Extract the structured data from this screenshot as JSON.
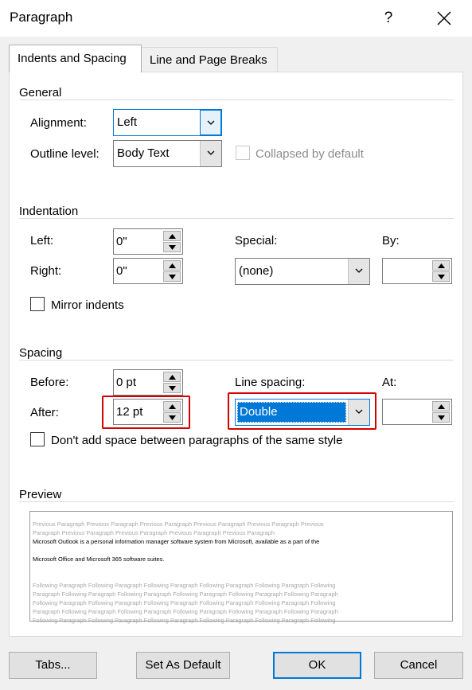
{
  "window": {
    "title": "Paragraph",
    "help_label": "?",
    "colors": {
      "accent": "#0078d7",
      "highlight_red": "#d40000",
      "selection": "#0078d7"
    }
  },
  "tabs": [
    {
      "label": "Indents and Spacing",
      "active": true
    },
    {
      "label": "Line and Page Breaks",
      "active": false
    }
  ],
  "general": {
    "heading": "General",
    "alignment": {
      "label": "Alignment:",
      "value": "Left"
    },
    "outline_level": {
      "label": "Outline level:",
      "value": "Body Text"
    },
    "collapsed": {
      "label": "Collapsed by default",
      "checked": false,
      "enabled": false
    }
  },
  "indentation": {
    "heading": "Indentation",
    "left": {
      "label": "Left:",
      "value": "0\""
    },
    "right": {
      "label": "Right:",
      "value": "0\""
    },
    "special": {
      "label": "Special:",
      "value": "(none)"
    },
    "by": {
      "label": "By:",
      "value": ""
    },
    "mirror": {
      "label": "Mirror indents",
      "checked": false
    }
  },
  "spacing": {
    "heading": "Spacing",
    "before": {
      "label": "Before:",
      "value": "0 pt"
    },
    "after": {
      "label": "After:",
      "value": "12 pt"
    },
    "line_spacing": {
      "label": "Line spacing:",
      "value": "Double"
    },
    "at": {
      "label": "At:",
      "value": ""
    },
    "dont_add": {
      "label": "Don't add space between paragraphs of the same style",
      "checked": false
    }
  },
  "preview": {
    "heading": "Preview",
    "previous_lines": [
      "Previous Paragraph Previous Paragraph Previous Paragraph Previous Paragraph Previous Paragraph Previous",
      "Paragraph Previous Paragraph Previous Paragraph Previous Paragraph Previous Paragraph"
    ],
    "sample_lines": [
      "Microsoft Outlook is a personal information manager software system from Microsoft, available as a part of the",
      "Microsoft Office and Microsoft 365 software suites."
    ],
    "following_lines": [
      "Following Paragraph Following Paragraph Following Paragraph Following Paragraph Following Paragraph Following",
      "Paragraph Following Paragraph Following Paragraph Following Paragraph Following Paragraph Following Paragraph",
      "Following Paragraph Following Paragraph Following Paragraph Following Paragraph Following Paragraph Following",
      "Paragraph Following Paragraph Following Paragraph Following Paragraph Following Paragraph Following Paragraph",
      "Following Paragraph Following Paragraph Following Paragraph Following Paragraph Following Paragraph Following"
    ]
  },
  "buttons": {
    "tabs": "Tabs...",
    "set_default": "Set As Default",
    "ok": "OK",
    "cancel": "Cancel"
  }
}
